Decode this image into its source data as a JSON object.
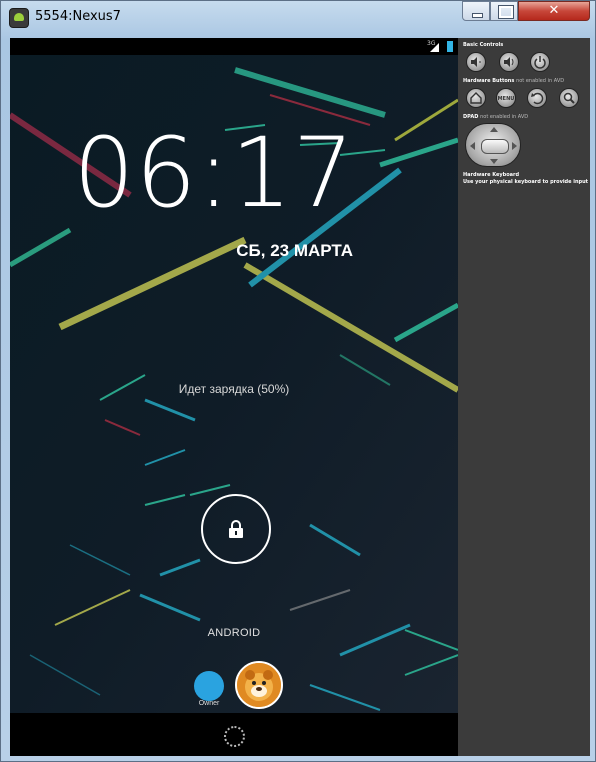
{
  "window": {
    "title": "5554:Nexus7",
    "close_label": "✕"
  },
  "device": {
    "status_bar": {
      "network": "3G"
    },
    "clock": {
      "time": "06:17"
    },
    "date": "СБ, 23 МАРТА",
    "charging_text": "Идет зарядка (50%)",
    "owner_info": "ANDROID",
    "users": [
      {
        "name": "Owner",
        "color": "#2aa3e0"
      },
      {
        "name": "",
        "color": "#e08a22"
      }
    ]
  },
  "controls_panel": {
    "basic_controls_label": "Basic Controls",
    "hardware_buttons_label": "Hardware Buttons",
    "hardware_buttons_note": "not enabled in AVD",
    "menu_label": "MENU",
    "dpad_label": "DPAD",
    "dpad_note": "not enabled in AVD",
    "keyboard_label": "Hardware Keyboard",
    "keyboard_note": "Use your physical keyboard to provide input"
  },
  "colors": {
    "lock_accent": "#33b5e5",
    "panel_bg": "#3b3b3b",
    "close_button": "#c7473a"
  }
}
